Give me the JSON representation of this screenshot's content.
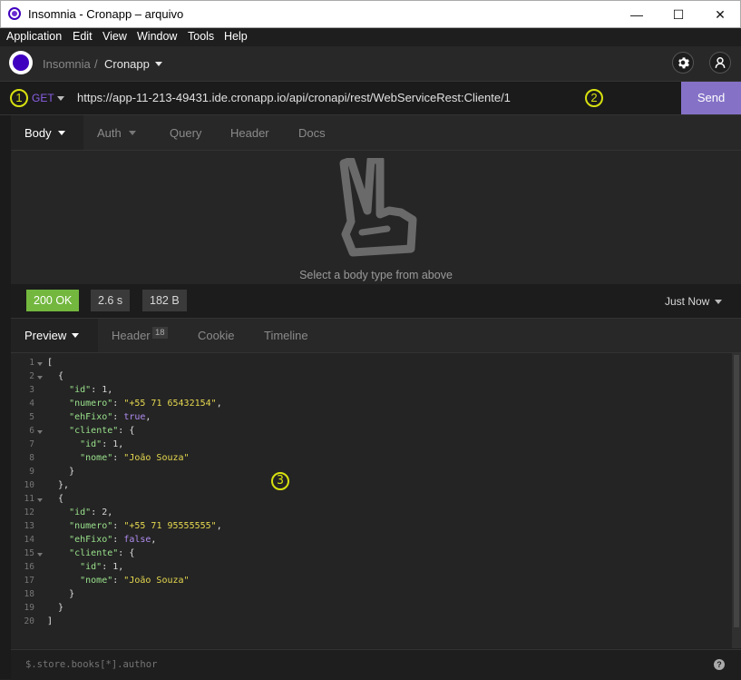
{
  "window": {
    "title": "Insomnia - Cronapp – arquivo",
    "minimize": "—",
    "maximize": "☐",
    "close": "✕"
  },
  "menu": [
    "Application",
    "Edit",
    "View",
    "Window",
    "Tools",
    "Help"
  ],
  "header": {
    "workspace": "Insomnia",
    "separator": "/",
    "collection": "Cronapp"
  },
  "request": {
    "method": "GET",
    "url": "https://app-11-213-49431.ide.cronapp.io/api/cronapi/rest/WebServiceRest:Cliente/1",
    "send_label": "Send",
    "tabs": [
      "Body",
      "Auth",
      "Query",
      "Header",
      "Docs"
    ],
    "empty_body_message": "Select a body type from above"
  },
  "markers": [
    "1",
    "2",
    "3"
  ],
  "response": {
    "status": "200 OK",
    "time": "2.6 s",
    "size": "182 B",
    "when": "Just Now",
    "tabs": [
      "Preview",
      "Header",
      "Cookie",
      "Timeline"
    ],
    "header_count": "18",
    "line_numbers": [
      "1",
      "2",
      "3",
      "4",
      "5",
      "6",
      "7",
      "8",
      "9",
      "10",
      "11",
      "12",
      "13",
      "14",
      "15",
      "16",
      "17",
      "18",
      "19",
      "20"
    ]
  },
  "json_response": [
    {
      "id": 1,
      "numero": "+55 71 65432154",
      "ehFixo": true,
      "cliente": {
        "id": 1,
        "nome": "João Souza"
      }
    },
    {
      "id": 2,
      "numero": "+55 71 95555555",
      "ehFixo": false,
      "cliente": {
        "id": 1,
        "nome": "João Souza"
      }
    }
  ],
  "filter": {
    "placeholder": "$.store.books[*].author"
  },
  "colors": {
    "accent": "#4000bf",
    "send": "#8572c7",
    "status_ok": "#73b73f",
    "marker": "#d8e10f",
    "json_key": "#9ae28c",
    "json_string": "#e6d84f",
    "json_bool": "#b08cf0"
  },
  "icons": {
    "settings": "gear-icon",
    "account": "user-icon",
    "empty_body": "peace-hand-icon",
    "help": "help-icon"
  }
}
